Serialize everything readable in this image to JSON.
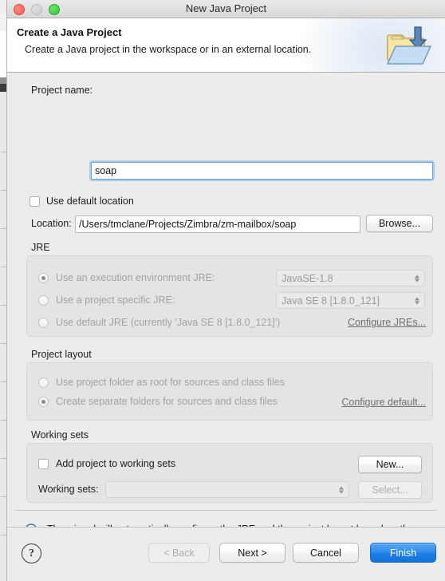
{
  "window": {
    "title": "New Java Project",
    "traffic_lights": [
      "close-button",
      "minimize-button",
      "maximize-button"
    ]
  },
  "header": {
    "title": "Create a Java Project",
    "subtitle": "Create a Java project in the workspace or in an external location.",
    "icon": "folder-import-icon"
  },
  "project_name": {
    "label": "Project name:",
    "value": "soap",
    "placeholder": ""
  },
  "location": {
    "use_default_checkbox_label": "Use default location",
    "use_default_checked": false,
    "label": "Location:",
    "value": "/Users/tmclane/Projects/Zimbra/zm-mailbox/soap",
    "browse_label": "Browse..."
  },
  "jre": {
    "group_title": "JRE",
    "options": [
      {
        "label": "Use an execution environment JRE:",
        "selected": true,
        "combo_value": "JavaSE-1.8"
      },
      {
        "label": "Use a project specific JRE:",
        "selected": false,
        "combo_value": "Java SE 8 [1.8.0_121]"
      },
      {
        "label": "Use default JRE (currently 'Java SE 8 [1.8.0_121]')",
        "selected": false,
        "combo_value": ""
      }
    ],
    "configure_link": "Configure JREs..."
  },
  "project_layout": {
    "group_title": "Project layout",
    "options": [
      {
        "label": "Use project folder as root for sources and class files",
        "selected": false
      },
      {
        "label": "Create separate folders for sources and class files",
        "selected": true
      }
    ],
    "configure_link": "Configure default..."
  },
  "working_sets": {
    "group_title": "Working sets",
    "add_checkbox_label": "Add project to working sets",
    "add_checked": false,
    "new_label": "New...",
    "combo_label": "Working sets:",
    "combo_value": "",
    "select_label": "Select..."
  },
  "info": {
    "icon": "info-icon",
    "message": "The wizard will automatically configure the JRE and the project layout based on the existing source."
  },
  "footer": {
    "help_label": "?",
    "back_label": "< Back",
    "next_label": "Next >",
    "cancel_label": "Cancel",
    "finish_label": "Finish"
  },
  "colors": {
    "accent_blue": "#1f80e8",
    "focus_ring": "#a8cbee",
    "dialog_bg": "#ececec",
    "group_bg": "#e4e4e4",
    "info_blue": "#3a6ea5"
  }
}
